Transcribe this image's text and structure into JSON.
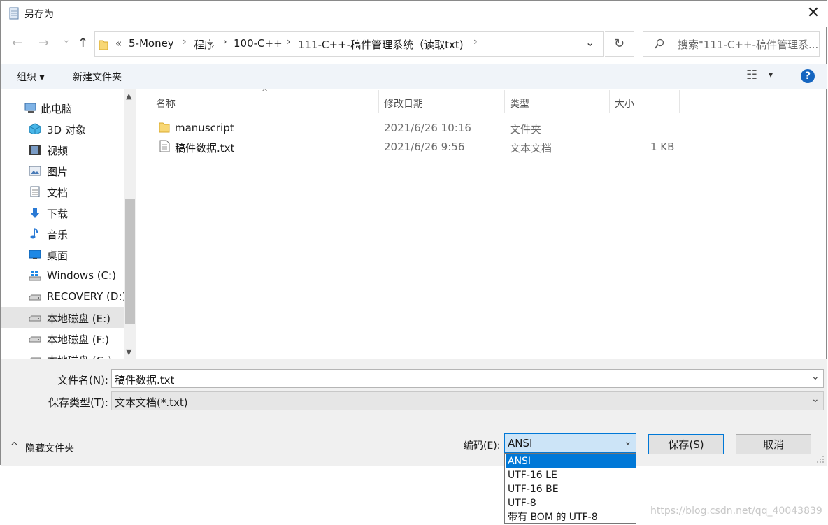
{
  "window": {
    "title": "另存为",
    "close_glyph": "✕"
  },
  "nav": {
    "back_glyph": "←",
    "forward_glyph": "→",
    "recent_glyph": "⌄",
    "up_glyph": "↑",
    "overflow_glyph": "«",
    "breadcrumbs": [
      "5-Money",
      "程序",
      "100-C++",
      "111-C++-稿件管理系统（读取txt)"
    ],
    "separator": "›",
    "dropdown_glyph": "⌄",
    "refresh_glyph": "↻",
    "search_placeholder": "搜索\"111-C++-稿件管理系...",
    "search_glyph": "⌕"
  },
  "toolbar": {
    "organize": "组织 ▾",
    "new_folder": "新建文件夹",
    "view_glyph": "☷",
    "view_dd": "▾",
    "help_glyph": "?"
  },
  "sidebar": {
    "items": [
      {
        "label": "此电脑",
        "icon": "computer-icon"
      },
      {
        "label": "3D 对象",
        "icon": "cube-icon"
      },
      {
        "label": "视频",
        "icon": "video-icon"
      },
      {
        "label": "图片",
        "icon": "picture-icon"
      },
      {
        "label": "文档",
        "icon": "document-icon"
      },
      {
        "label": "下载",
        "icon": "download-icon"
      },
      {
        "label": "音乐",
        "icon": "music-icon"
      },
      {
        "label": "桌面",
        "icon": "desktop-icon"
      },
      {
        "label": "Windows (C:)",
        "icon": "windows-drive-icon"
      },
      {
        "label": "RECOVERY (D:)",
        "icon": "drive-icon"
      },
      {
        "label": "本地磁盘 (E:)",
        "icon": "drive-icon"
      },
      {
        "label": "本地磁盘 (F:)",
        "icon": "drive-icon"
      },
      {
        "label": "本地磁盘 (G:)",
        "icon": "drive-icon"
      }
    ],
    "selected": "本地磁盘 (E:)"
  },
  "columns": {
    "name": "名称",
    "modified": "修改日期",
    "type": "类型",
    "size": "大小",
    "sort_glyph": "^"
  },
  "files": [
    {
      "name": "manuscript",
      "modified": "2021/6/26 10:16",
      "type": "文件夹",
      "size": "",
      "icon": "folder-icon"
    },
    {
      "name": "稿件数据.txt",
      "modified": "2021/6/26 9:56",
      "type": "文本文档",
      "size": "1 KB",
      "icon": "text-file-icon"
    }
  ],
  "form": {
    "filename_label": "文件名(N):",
    "filename_value": "稿件数据.txt",
    "filetype_label": "保存类型(T):",
    "filetype_value": "文本文档(*.txt)",
    "hide_folders": "隐藏文件夹",
    "hide_glyph": "^",
    "encoding_label": "编码(E):",
    "encoding_value": "ANSI",
    "encoding_options": [
      "ANSI",
      "UTF-16 LE",
      "UTF-16 BE",
      "UTF-8",
      "带有 BOM 的 UTF-8"
    ],
    "save_button": "保存(S)",
    "cancel_button": "取消",
    "dd_glyph": "⌄"
  },
  "watermark": "https://blog.csdn.net/qq_40043839"
}
